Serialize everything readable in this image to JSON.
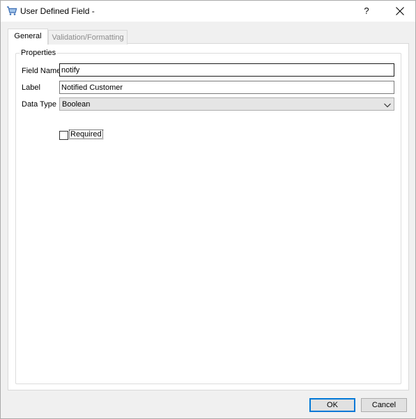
{
  "window": {
    "title": "User Defined Field -",
    "help_label": "?",
    "app_icon": "cart-icon",
    "close_icon": "close-icon"
  },
  "tabs": [
    {
      "label": "General",
      "active": true
    },
    {
      "label": "Validation/Formatting",
      "active": false
    }
  ],
  "properties": {
    "group_label": "Properties",
    "field_name": {
      "label": "Field Name",
      "value": "notify"
    },
    "label": {
      "label": "Label",
      "value": "Notified Customer"
    },
    "data_type": {
      "label": "Data Type",
      "value": "Boolean"
    },
    "required": {
      "label": "Required",
      "checked": false
    }
  },
  "buttons": {
    "ok": "OK",
    "cancel": "Cancel"
  },
  "colors": {
    "focus_border": "#0078d7",
    "disabled_text": "#8c8c8c"
  }
}
